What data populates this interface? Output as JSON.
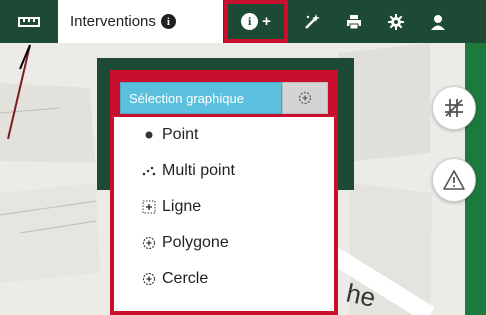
{
  "toolbar": {
    "tab_label": "Interventions",
    "infoplus_label": "+"
  },
  "selection": {
    "button_label": "Sélection graphique"
  },
  "menu": {
    "items": [
      {
        "label": "Point",
        "icon": "point-icon"
      },
      {
        "label": "Multi point",
        "icon": "multi-point-icon"
      },
      {
        "label": "Ligne",
        "icon": "line-icon"
      },
      {
        "label": "Polygone",
        "icon": "polygon-icon"
      },
      {
        "label": "Cercle",
        "icon": "circle-icon"
      }
    ]
  },
  "map": {
    "street_label_fragment": "he"
  },
  "colors": {
    "toolbar": "#1d4a35",
    "highlight": "#c8102e",
    "selection_button": "#5bc0de"
  }
}
